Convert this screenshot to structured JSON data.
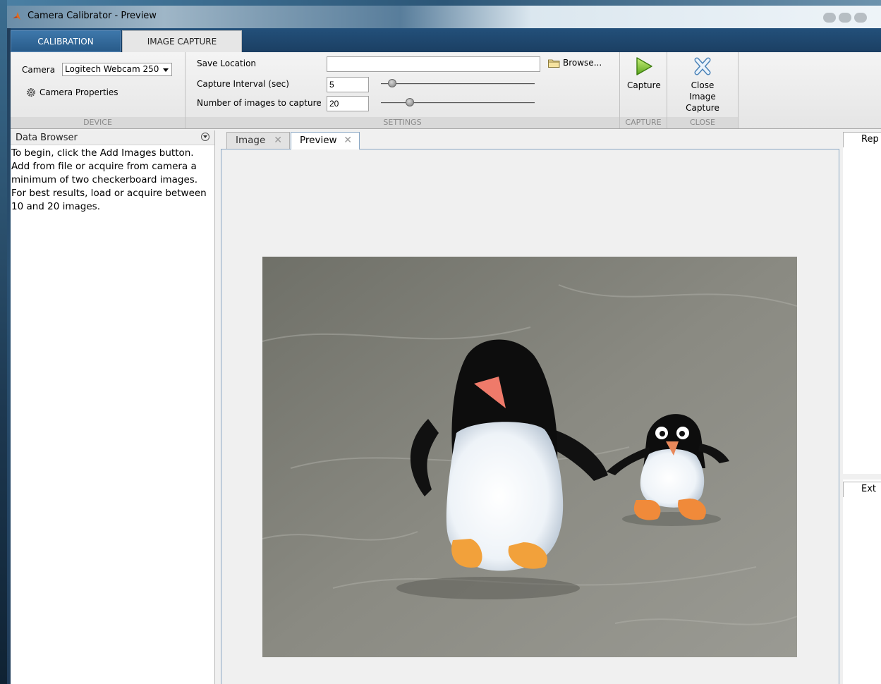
{
  "window": {
    "title": "Camera Calibrator - Preview"
  },
  "ribbon": {
    "tabs": [
      "CALIBRATION",
      "IMAGE CAPTURE"
    ],
    "device": {
      "camera_label": "Camera",
      "camera_value": "Logitech Webcam 250",
      "properties_label": "Camera Properties",
      "section_label": "DEVICE"
    },
    "settings": {
      "save_location_label": "Save Location",
      "save_location_value": "",
      "browse_label": "Browse...",
      "interval_label": "Capture Interval (sec)",
      "interval_value": "5",
      "interval_slider_fraction": 0.05,
      "count_label": "Number of images to capture",
      "count_value": "20",
      "count_slider_fraction": 0.17,
      "section_label": "SETTINGS"
    },
    "capture": {
      "button_label": "Capture",
      "section_label": "CAPTURE"
    },
    "close": {
      "button_line1": "Close",
      "button_line2": "Image Capture",
      "section_label": "CLOSE"
    }
  },
  "data_browser": {
    "title": "Data Browser",
    "message": "To begin, click the Add Images button. Add from file or acquire from camera a minimum of two checkerboard images. For best results, load or acquire between 10 and 20 images."
  },
  "doc_tabs": [
    {
      "label": "Image",
      "active": false
    },
    {
      "label": "Preview",
      "active": true
    }
  ],
  "right_panels": {
    "top_label": "Rep",
    "bottom_label": "Ext"
  }
}
